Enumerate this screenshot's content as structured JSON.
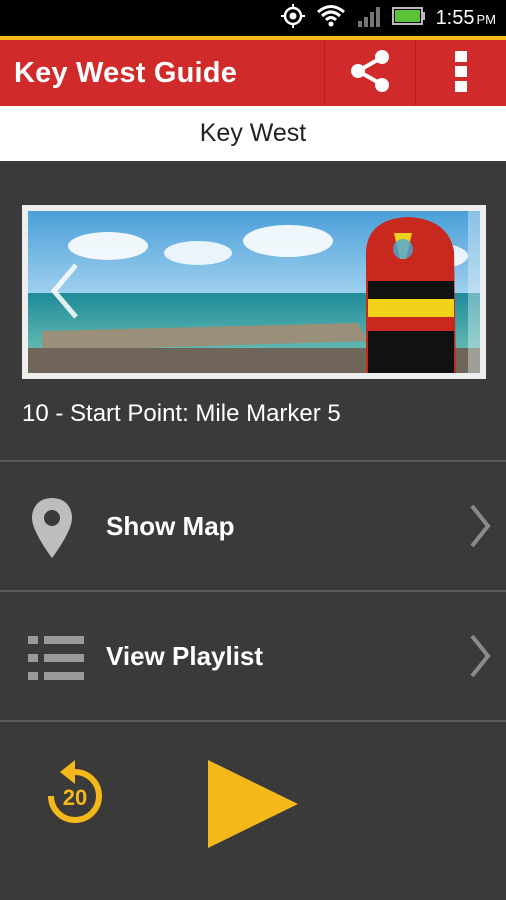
{
  "status_bar": {
    "time": "1:55",
    "ampm": "PM"
  },
  "app_bar": {
    "title": "Key West Guide",
    "share_icon": "share-icon",
    "overflow_icon": "more-vert-icon"
  },
  "subtitle": "Key West",
  "hero": {
    "caption": "10 - Start Point: Mile Marker 5",
    "prev_icon": "chevron-left-icon"
  },
  "menu": {
    "items": [
      {
        "label": "Show Map",
        "icon": "map-pin-icon"
      },
      {
        "label": "View Playlist",
        "icon": "list-icon"
      }
    ]
  },
  "player": {
    "replay_label": "20",
    "replay_icon": "replay-20-icon",
    "play_icon": "play-icon"
  },
  "colors": {
    "appbar": "#d12a2a",
    "accent": "#f4b81b",
    "background": "#3a3a3a"
  }
}
